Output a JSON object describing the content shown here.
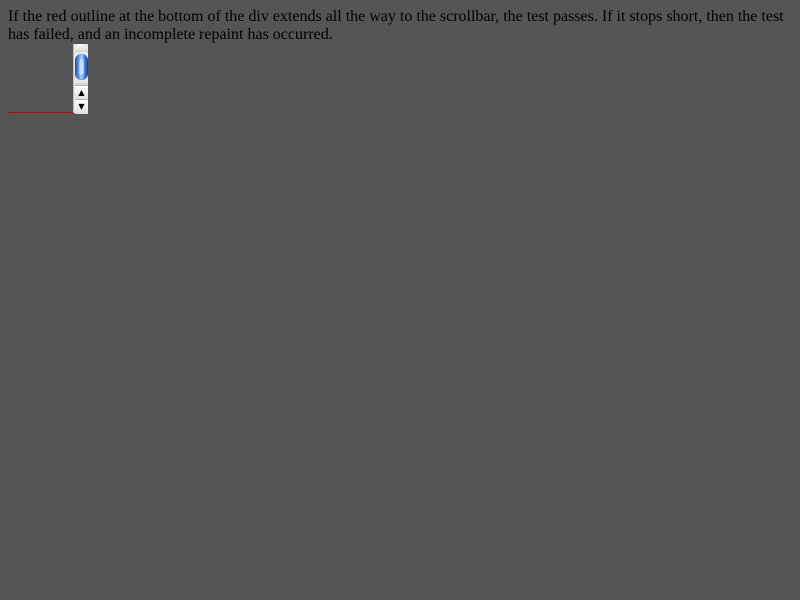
{
  "instructions": {
    "text": "If the red outline at the bottom of the div extends all the way to the scrollbar, the test passes. If it stops short, then the test has failed, and an incomplete repaint has occurred."
  },
  "colors": {
    "background": "#555555",
    "outline": "#cc0000",
    "scroll_thumb": "#4f86f0"
  },
  "scrollbar": {
    "up_arrow_icon": "▲",
    "down_arrow_icon": "▼"
  }
}
